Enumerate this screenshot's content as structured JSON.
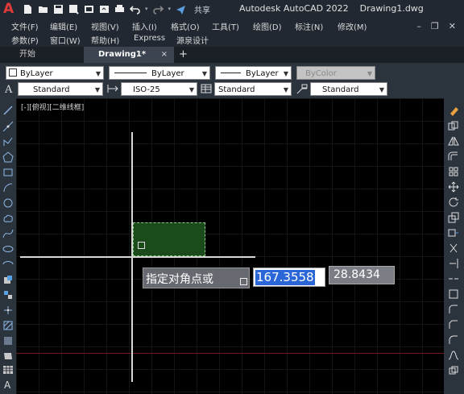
{
  "titlebar": {
    "logo": "A",
    "share": "共享",
    "app_title": "Autodesk AutoCAD 2022",
    "file_name": "Drawing1.dwg"
  },
  "menu": [
    "文件(F)",
    "编辑(E)",
    "视图(V)",
    "插入(I)",
    "格式(O)",
    "工具(T)",
    "绘图(D)",
    "标注(N)",
    "修改(M)",
    "参数(P)",
    "窗口(W)",
    "帮助(H)",
    "Express",
    "源泉设计"
  ],
  "tabs": {
    "start": "开始",
    "active": "Drawing1*",
    "close": "×",
    "add": "+"
  },
  "properties": {
    "color": "ByLayer",
    "linetype": "ByLayer",
    "lineweight": "ByLayer",
    "plotstyle": "ByColor"
  },
  "styles": {
    "text_style": "Standard",
    "dim_style": "ISO-25",
    "table_style": "Standard",
    "multileader_style": "Standard"
  },
  "viewport": {
    "label": "[-][俯视][二维线框]"
  },
  "command": {
    "prompt": "指定对角点或",
    "x_value": "167.3558",
    "y_value": "28.8434"
  },
  "colors": {
    "accent": "#2a66d8",
    "selection_fill": "#1b4a1b",
    "background": "#000000"
  }
}
